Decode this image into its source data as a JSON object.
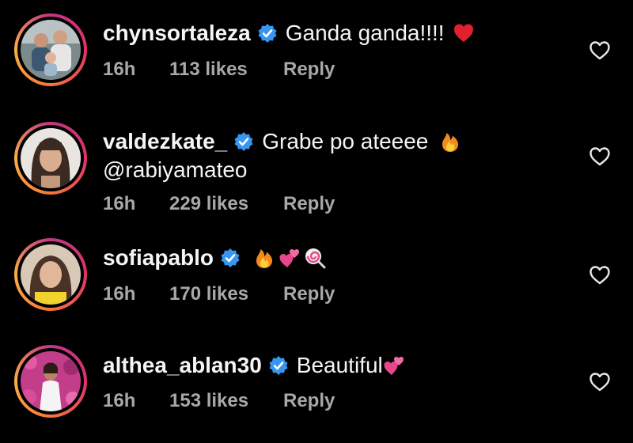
{
  "colors": {
    "background": "#000000",
    "text": "#f5f5f5",
    "meta": "#a8a8a8",
    "verified": "#3797f0"
  },
  "comments": [
    {
      "username": "chynsortaleza",
      "verified": true,
      "text": "Ganda ganda!!!!",
      "emoji": [
        "red-heart"
      ],
      "time": "16h",
      "likes": "113 likes",
      "reply": "Reply",
      "avatar": "family-photo-avatar"
    },
    {
      "username": "valdezkate_",
      "verified": true,
      "text": "Grabe po ateeee",
      "emoji": [
        "fire"
      ],
      "text_line2": "@rabiyamateo",
      "time": "16h",
      "likes": "229 likes",
      "reply": "Reply",
      "avatar": "woman-portrait-avatar"
    },
    {
      "username": "sofiapablo",
      "verified": true,
      "text": "",
      "emoji": [
        "fire",
        "two-hearts",
        "lollipop"
      ],
      "time": "16h",
      "likes": "170 likes",
      "reply": "Reply",
      "avatar": "woman-yellow-avatar"
    },
    {
      "username": "althea_ablan30",
      "verified": true,
      "text": "Beautiful",
      "emoji": [
        "two-hearts"
      ],
      "time": "16h",
      "likes": "153 likes",
      "reply": "Reply",
      "avatar": "woman-flowers-avatar"
    }
  ]
}
